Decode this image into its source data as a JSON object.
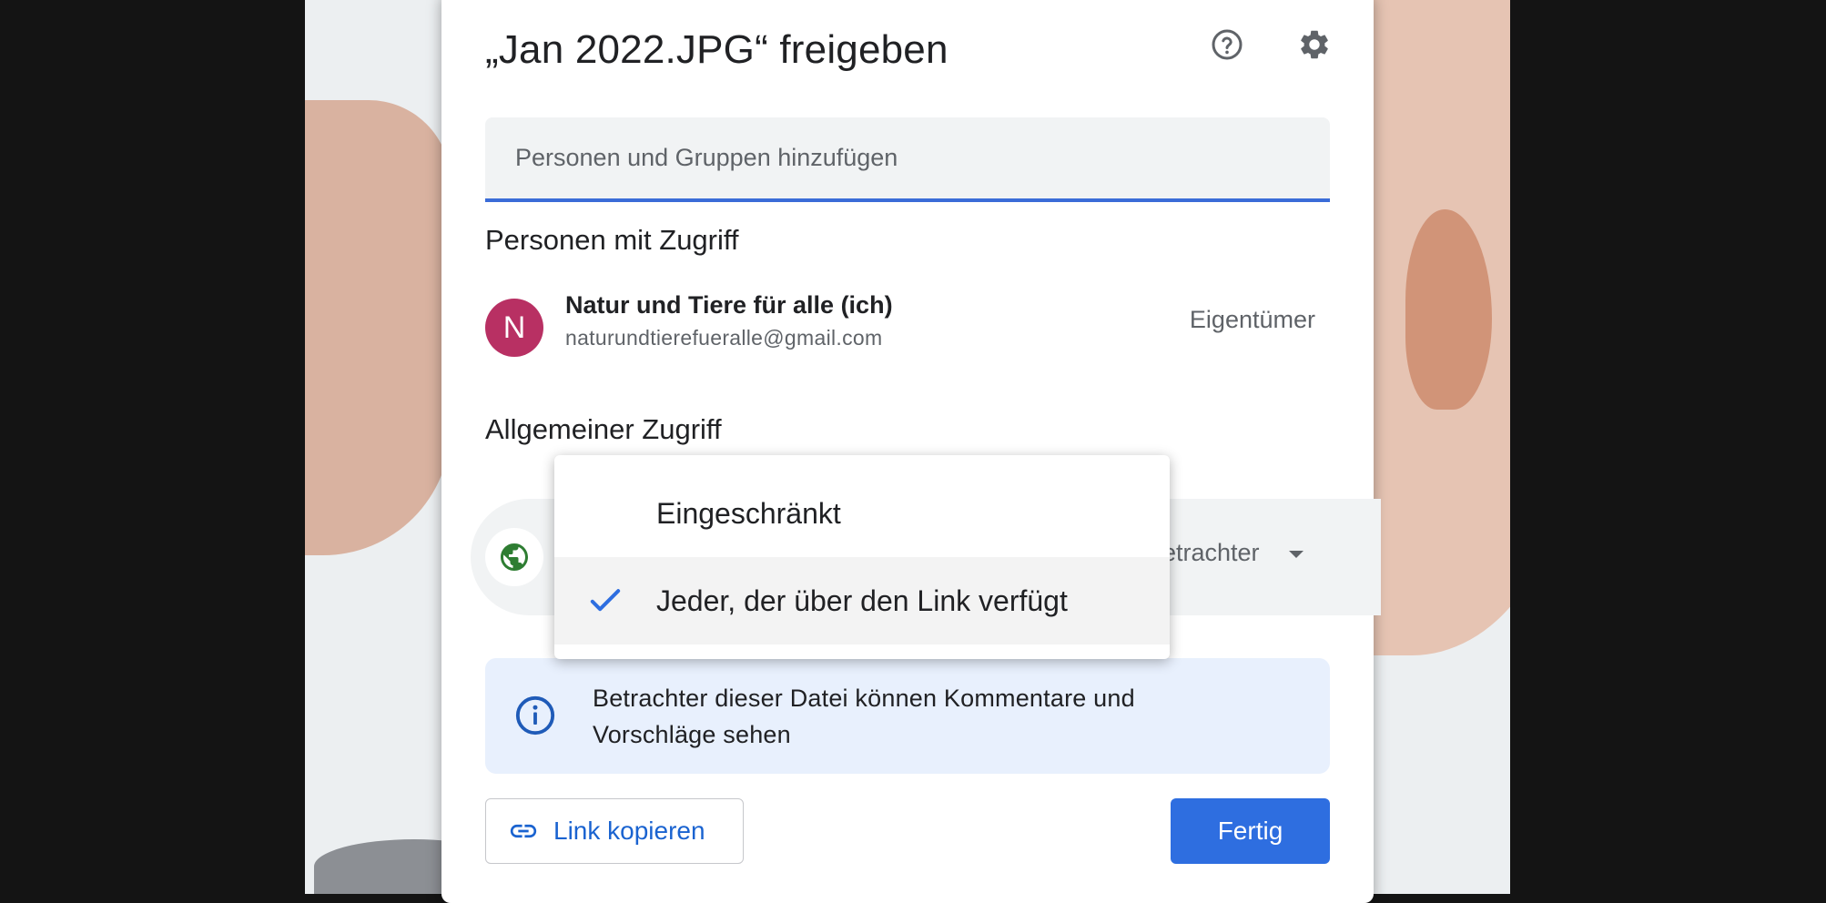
{
  "dialog": {
    "title": "„Jan 2022.JPG“ freigeben",
    "help_icon": "help-circle-icon",
    "settings_icon": "gear-icon"
  },
  "add_people": {
    "placeholder": "Personen und Gruppen hinzufügen"
  },
  "people_with_access": {
    "heading": "Personen mit Zugriff",
    "people": [
      {
        "avatar_letter": "N",
        "name": "Natur und Tiere für alle (ich)",
        "email": "naturundtierefueralle@gmail.com",
        "role": "Eigentümer",
        "avatar_color": "#b83063"
      }
    ]
  },
  "general_access": {
    "heading": "Allgemeiner Zugriff",
    "icon": "globe-icon",
    "role_visible": "etrachter"
  },
  "dropdown": {
    "options": [
      {
        "label": "Eingeschränkt",
        "selected": false
      },
      {
        "label": "Jeder, der über den Link verfügt",
        "selected": true
      }
    ]
  },
  "info": {
    "icon": "info-icon",
    "text_line1": "Betrachter dieser Datei können Kommentare und",
    "text_line2": "Vorschläge sehen"
  },
  "buttons": {
    "copy_link": "Link kopieren",
    "done": "Fertig"
  },
  "colors": {
    "accent": "#2e6ee0",
    "link_text": "#1a63d0",
    "info_bg": "#e8f0fd",
    "globe": "#2e7d32"
  }
}
